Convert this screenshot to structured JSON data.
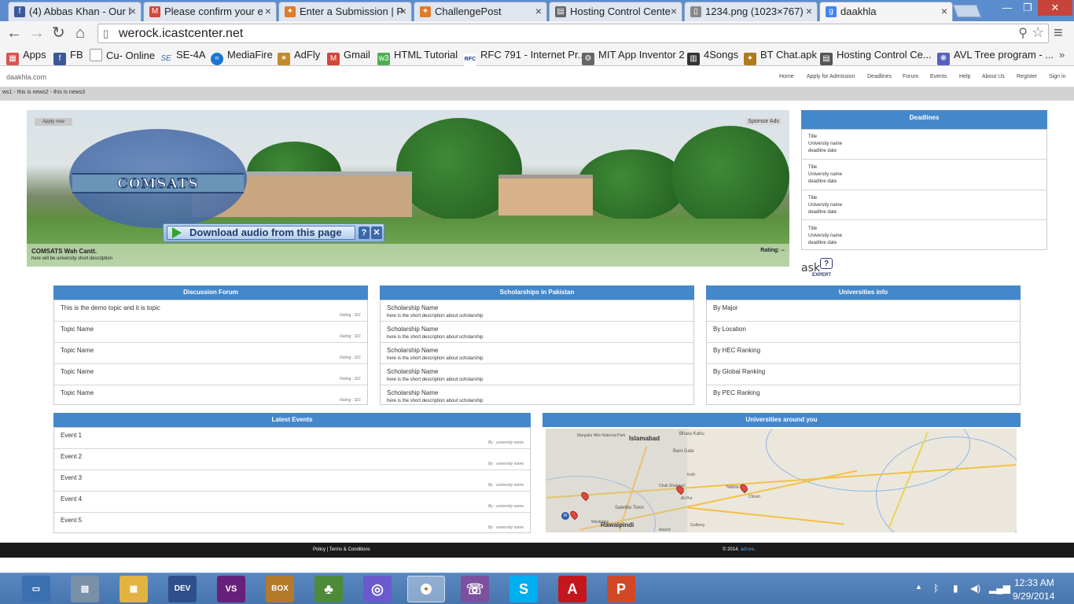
{
  "browser": {
    "tabs": [
      {
        "title": "(4) Abbas Khan - Our l",
        "icon": "facebook-icon",
        "color": "#3b5998"
      },
      {
        "title": "Please confirm your e",
        "icon": "gmail-icon",
        "color": "#d44638"
      },
      {
        "title": "Enter a Submission | P",
        "icon": "challengepost-icon",
        "color": "#e07b2a"
      },
      {
        "title": "ChallengePost",
        "icon": "challengepost-icon",
        "color": "#e07b2a"
      },
      {
        "title": "Hosting Control Cente",
        "icon": "hosting-icon",
        "color": "#666666"
      },
      {
        "title": "1234.png (1023×767)",
        "icon": "document-icon",
        "color": "#888888"
      },
      {
        "title": "daakhla",
        "icon": "google-icon",
        "color": "#4285f4"
      }
    ],
    "url": "werock.icastcenter.net",
    "bookmarks": [
      {
        "label": "Apps",
        "icon": "apps-grid-icon",
        "color": "#d9534f"
      },
      {
        "label": "FB",
        "icon": "facebook-icon",
        "color": "#3b5998"
      },
      {
        "label": "Cu- Online",
        "icon": "page-icon",
        "color": "#999999"
      },
      {
        "label": "SE-4A",
        "icon": "se-icon",
        "color": "#2a6ebb"
      },
      {
        "label": "MediaFire",
        "icon": "mediafire-icon",
        "color": "#1a76d2"
      },
      {
        "label": "AdFly",
        "icon": "adfly-icon",
        "color": "#c28a2a"
      },
      {
        "label": "Gmail",
        "icon": "gmail-icon",
        "color": "#d44638"
      },
      {
        "label": "HTML Tutorial",
        "icon": "w3-icon",
        "color": "#4caf50"
      },
      {
        "label": "RFC 791 - Internet Pr...",
        "icon": "rfc-icon",
        "color": "#1a3a8a"
      },
      {
        "label": "MIT App Inventor 2",
        "icon": "app-inventor-icon",
        "color": "#666666"
      },
      {
        "label": "4Songs",
        "icon": "songs-icon",
        "color": "#333333"
      },
      {
        "label": "BT Chat.apk",
        "icon": "bt-icon",
        "color": "#b07a1a"
      },
      {
        "label": "Hosting Control Ce...",
        "icon": "hosting-icon",
        "color": "#555555"
      },
      {
        "label": "AVL Tree program - ...",
        "icon": "avl-icon",
        "color": "#5560c0"
      }
    ]
  },
  "site": {
    "logo": "daakhla.com",
    "menu": [
      "Home",
      "Apply for Admission",
      "Deadlines",
      "Forum",
      "Events",
      "Help",
      "About Us",
      "Register",
      "Sign in"
    ],
    "ticker": "ws1 - this is news2 - this is news3",
    "hero": {
      "apply": "Apply now",
      "sponsor": "Sponsor Ads",
      "logo_text": "COMSATS",
      "title": "COMSATS Wah Cantt.",
      "desc": "here will be university short description",
      "rating": "Rating: --",
      "download": "Download audio from this page"
    },
    "deadlines": {
      "title": "Deadlines",
      "items": [
        {
          "title": "Title",
          "uni": "University name",
          "date": "deadline date"
        },
        {
          "title": "Title",
          "uni": "University name",
          "date": "deadline date"
        },
        {
          "title": "Title",
          "uni": "University name",
          "date": "deadline date"
        },
        {
          "title": "Title",
          "uni": "University name",
          "date": "deadline date"
        }
      ]
    },
    "ask": {
      "main": "ask",
      "sub": "EXPERT"
    },
    "forum": {
      "title": "Discussion Forum",
      "items": [
        {
          "topic": "This is the demo topic and it is topic",
          "rating": "Rating : 321"
        },
        {
          "topic": "Topic Name",
          "rating": "Rating : 321"
        },
        {
          "topic": "Topic Name",
          "rating": "Rating : 321"
        },
        {
          "topic": "Topic Name",
          "rating": "Rating : 321"
        },
        {
          "topic": "Topic Name",
          "rating": "Rating : 321"
        }
      ]
    },
    "scholarships": {
      "title": "Scholarships in Pakistan",
      "items": [
        {
          "name": "Scholarship Name",
          "desc": "here is the short description about scholarship"
        },
        {
          "name": "Scholarship Name",
          "desc": "here is the short description about scholarship"
        },
        {
          "name": "Scholarship Name",
          "desc": "here is the short description about scholarship"
        },
        {
          "name": "Scholarship Name",
          "desc": "here is the short description about scholarship"
        },
        {
          "name": "Scholarship Name",
          "desc": "here is the short description about scholarship"
        }
      ]
    },
    "universities": {
      "title": "Universities info",
      "items": [
        "By Major",
        "By Location",
        "By HEC Ranking",
        "By Global Ranking",
        "By PEC Ranking"
      ]
    },
    "events": {
      "title": "Latest Events",
      "items": [
        {
          "name": "Event 1",
          "by": "By : university name"
        },
        {
          "name": "Event 2",
          "by": "By : university name"
        },
        {
          "name": "Event 3",
          "by": "By : university name"
        },
        {
          "name": "Event 4",
          "by": "By : university name"
        },
        {
          "name": "Event 5",
          "by": "By : university name"
        }
      ]
    },
    "around": {
      "title": "Universities around you",
      "map_labels": [
        "Islamabad",
        "Rawalpindi",
        "Bhara Kahu",
        "Bani Gala",
        "Satellite Town",
        "Westridge",
        "Margalla Hills National Park",
        "Chak Shahzad",
        "Nilore",
        "Chirah",
        "Airport",
        "Ali Pur",
        "Gulberg",
        "Kotli"
      ]
    },
    "footer": {
      "links": "Policy | Terms & Conditions",
      "copy_prefix": "© 2014. ",
      "copy_link": "adrore",
      "copy_suffix": "."
    }
  },
  "taskbar": {
    "icons": [
      {
        "name": "show-desktop-icon",
        "label": "▭",
        "color": "#3a6fb0"
      },
      {
        "name": "task-manager-icon",
        "label": "▤",
        "color": "#7a8fa8"
      },
      {
        "name": "file-explorer-icon",
        "label": "▦",
        "color": "#e3b341"
      },
      {
        "name": "devcpp-icon",
        "label": "DEV",
        "color": "#2f4f8a"
      },
      {
        "name": "visual-studio-icon",
        "label": "VS",
        "color": "#68217a"
      },
      {
        "name": "dosbox-icon",
        "label": "BOX",
        "color": "#b37a2a"
      },
      {
        "name": "solitaire-icon",
        "label": "♣",
        "color": "#4d8a3a"
      },
      {
        "name": "app-circle-icon",
        "label": "◎",
        "color": "#6a5acd"
      },
      {
        "name": "chrome-icon",
        "label": "◉",
        "color": "#d9a02a"
      },
      {
        "name": "viber-icon",
        "label": "☏",
        "color": "#7b519d"
      },
      {
        "name": "skype-icon",
        "label": "S",
        "color": "#00aff0"
      },
      {
        "name": "acrobat-icon",
        "label": "A",
        "color": "#c4161c"
      },
      {
        "name": "powerpoint-icon",
        "label": "P",
        "color": "#d24726"
      }
    ],
    "time": "12:33 AM",
    "date": "9/29/2014"
  }
}
